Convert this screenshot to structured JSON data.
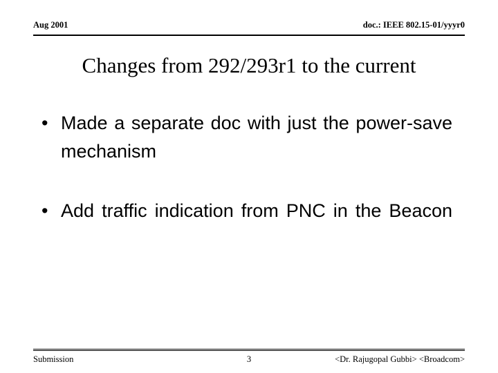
{
  "header": {
    "left": "Aug 2001",
    "right": "doc.: IEEE 802.15-01/yyyr0"
  },
  "title": "Changes from 292/293r1 to the current",
  "body": {
    "bullets": [
      {
        "marker": "•",
        "text": "Made a separate doc with just the power-save mechanism"
      },
      {
        "marker": "•",
        "text": "Add traffic indication from PNC in the Beacon"
      }
    ]
  },
  "footer": {
    "left": "Submission",
    "center": "3",
    "right": "<Dr. Rajugopal Gubbi> <Broadcom>"
  },
  "colors": {
    "text": "#000000",
    "background": "#ffffff",
    "rule": "#000000"
  }
}
